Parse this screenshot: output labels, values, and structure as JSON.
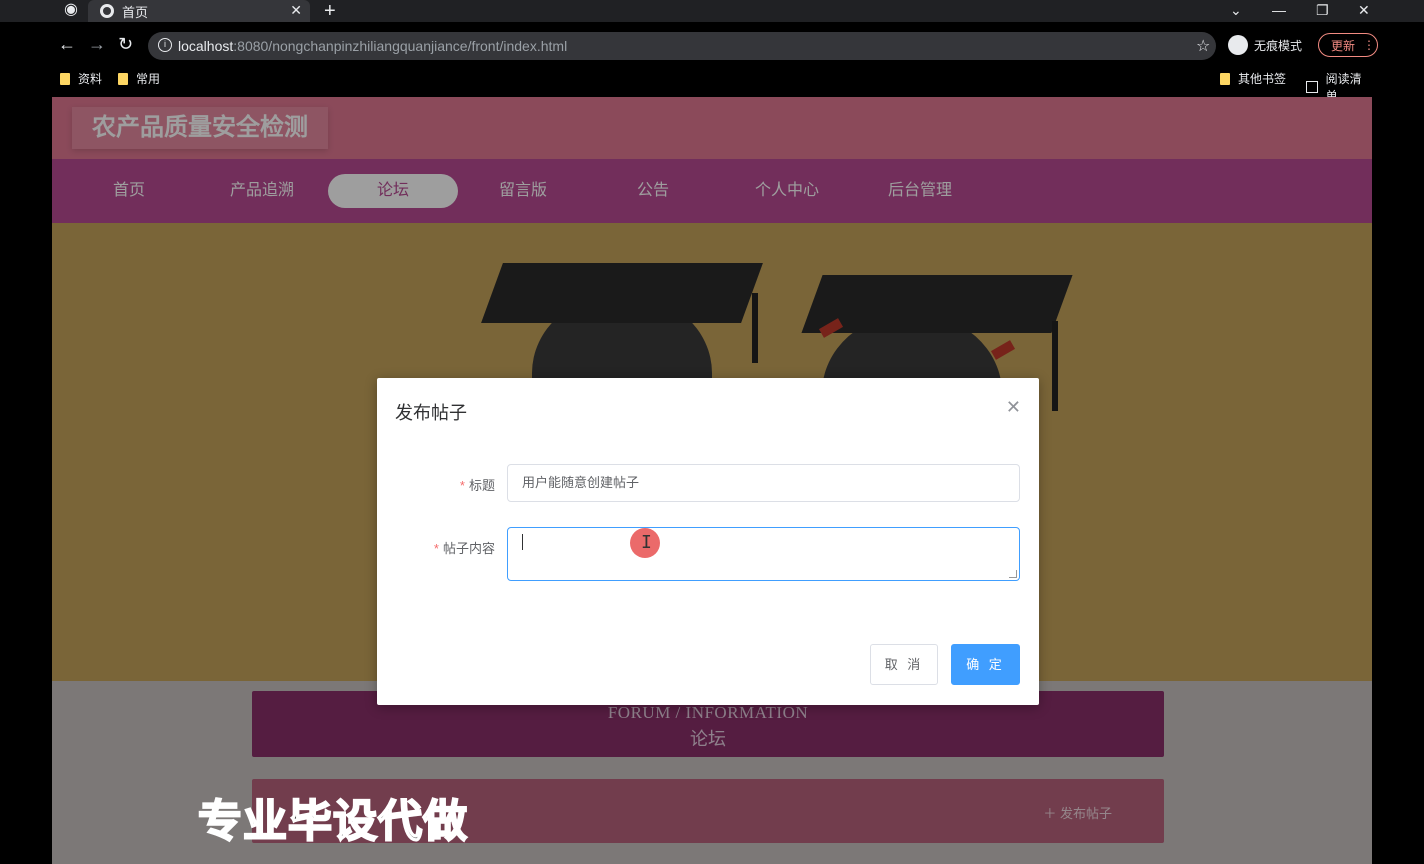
{
  "browser": {
    "tab_title": "首页",
    "new_tab": "+",
    "url_host": "localhost",
    "url_rest": ":8080/nongchanpinzhiliangquanjiance/front/index.html",
    "incognito_label": "无痕模式",
    "update_label": "更新",
    "bookmarks": [
      "资料",
      "常用"
    ],
    "other_bookmarks": "其他书签",
    "reading_list": "阅读清单"
  },
  "site": {
    "title": "农产品质量安全检测",
    "nav": [
      "首页",
      "产品追溯",
      "论坛",
      "留言版",
      "公告",
      "个人中心",
      "后台管理"
    ],
    "active_nav": "论坛"
  },
  "forum": {
    "heading_en": "FORUM / INFORMATION",
    "heading_cn": "论坛",
    "post_link": "发布帖子"
  },
  "dialog": {
    "title": "发布帖子",
    "fields": [
      {
        "label": "标题",
        "required": true,
        "value": "用户能随意创建帖子"
      },
      {
        "label": "帖子内容",
        "required": true,
        "value": ""
      }
    ],
    "cancel": "取 消",
    "confirm": "确 定"
  },
  "watermark": "专业毕设代做",
  "colors": {
    "header": "#e07892",
    "navbar": "#b84b94",
    "primary": "#409eff",
    "forum_box": "#8a2f6a"
  }
}
